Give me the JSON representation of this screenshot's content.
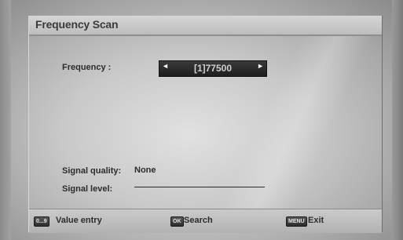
{
  "window": {
    "title": "Frequency Scan"
  },
  "frequency": {
    "label": "Frequency :",
    "value": "[1]77500",
    "left_arrow": "◄",
    "right_arrow": "►"
  },
  "signal": {
    "quality_label": "Signal quality:",
    "quality_value": "None",
    "level_label": "Signal level:"
  },
  "footer": {
    "items": [
      {
        "key": "0...9",
        "label": "Value entry"
      },
      {
        "key": "OK",
        "label": "Search"
      },
      {
        "key": "MENU",
        "label": "Exit"
      }
    ]
  }
}
